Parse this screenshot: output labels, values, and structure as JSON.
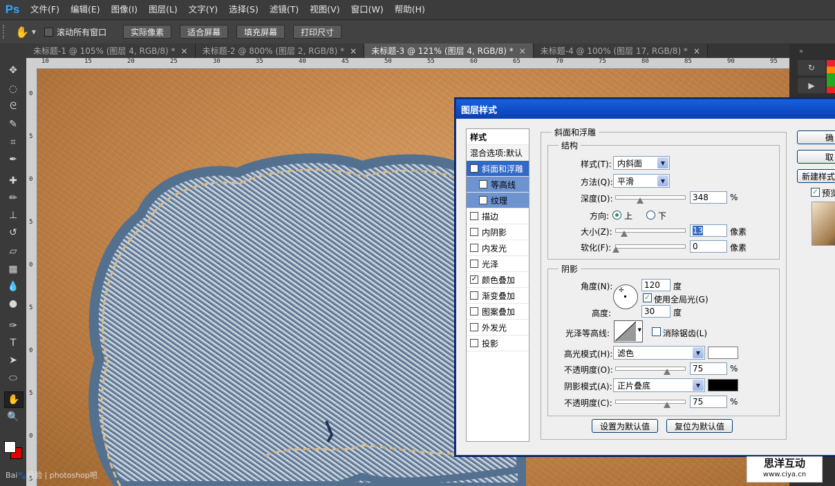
{
  "app": {
    "logo": "Ps"
  },
  "menu": [
    "文件(F)",
    "编辑(E)",
    "图像(I)",
    "图层(L)",
    "文字(Y)",
    "选择(S)",
    "滤镜(T)",
    "视图(V)",
    "窗口(W)",
    "帮助(H)"
  ],
  "options": {
    "scroll_all": "滚动所有窗口",
    "buttons": [
      "实际像素",
      "适合屏幕",
      "填充屏幕",
      "打印尺寸"
    ]
  },
  "tabs": [
    {
      "label": "未标题-1 @ 105% (图层 4, RGB/8) *"
    },
    {
      "label": "未标题-2 @ 800% (图层 2, RGB/8) *"
    },
    {
      "label": "未标题-3 @ 121% (图层 4, RGB/8) *"
    },
    {
      "label": "未标题-4 @ 100% (图层 17, RGB/8) *"
    }
  ],
  "active_tab": 2,
  "ruler_h": [
    "10",
    "15",
    "20",
    "25",
    "30",
    "35",
    "40",
    "45",
    "50",
    "55",
    "60",
    "65",
    "70",
    "75",
    "80",
    "85",
    "90",
    "95"
  ],
  "ruler_v": [
    "0",
    "5",
    "0",
    "5",
    "0",
    "5",
    "0",
    "5",
    "0",
    "5"
  ],
  "dialog": {
    "title": "图层样式",
    "styles_header": "样式",
    "blend_options": "混合选项:默认",
    "style_items": [
      {
        "label": "斜面和浮雕",
        "checked": true
      },
      {
        "label": "等高线",
        "checked": false
      },
      {
        "label": "纹理",
        "checked": false
      },
      {
        "label": "描边",
        "checked": false
      },
      {
        "label": "内阴影",
        "checked": false
      },
      {
        "label": "内发光",
        "checked": false
      },
      {
        "label": "光泽",
        "checked": false
      },
      {
        "label": "颜色叠加",
        "checked": true
      },
      {
        "label": "渐变叠加",
        "checked": false
      },
      {
        "label": "图案叠加",
        "checked": false
      },
      {
        "label": "外发光",
        "checked": false
      },
      {
        "label": "投影",
        "checked": false
      }
    ],
    "bevel": {
      "title": "斜面和浮雕",
      "structure_title": "结构",
      "style_label": "样式(T):",
      "style_value": "内斜面",
      "technique_label": "方法(Q):",
      "technique_value": "平滑",
      "depth_label": "深度(D):",
      "depth_value": "348",
      "depth_unit": "%",
      "direction_label": "方向:",
      "dir_up": "上",
      "dir_down": "下",
      "size_label": "大小(Z):",
      "size_value": "13",
      "size_unit": "像素",
      "soften_label": "软化(F):",
      "soften_value": "0",
      "soften_unit": "像素"
    },
    "shading": {
      "title": "阴影",
      "angle_label": "角度(N):",
      "angle_value": "120",
      "angle_unit": "度",
      "global_light": "使用全局光(G)",
      "altitude_label": "高度:",
      "altitude_value": "30",
      "altitude_unit": "度",
      "gloss_label": "光泽等高线:",
      "anti_alias": "消除锯齿(L)",
      "highlight_mode_label": "高光模式(H):",
      "highlight_mode_value": "滤色",
      "highlight_opacity_label": "不透明度(O):",
      "highlight_opacity_value": "75",
      "highlight_opacity_unit": "%",
      "shadow_mode_label": "阴影模式(A):",
      "shadow_mode_value": "正片叠底",
      "shadow_opacity_label": "不透明度(C):",
      "shadow_opacity_value": "75",
      "shadow_opacity_unit": "%"
    },
    "make_default": "设置为默认值",
    "reset_default": "复位为默认值",
    "side_buttons": [
      "确",
      "取",
      "新建样式"
    ],
    "preview_label": "预览"
  },
  "watermark": {
    "main": "思洋互动",
    "url": "www.ciya.cn",
    "left": "Bai🐾经验 | photoshop吧"
  },
  "colors": {
    "accent": "#3169c6",
    "highlight_swatch": "#ffffff",
    "shadow_swatch": "#000000"
  }
}
